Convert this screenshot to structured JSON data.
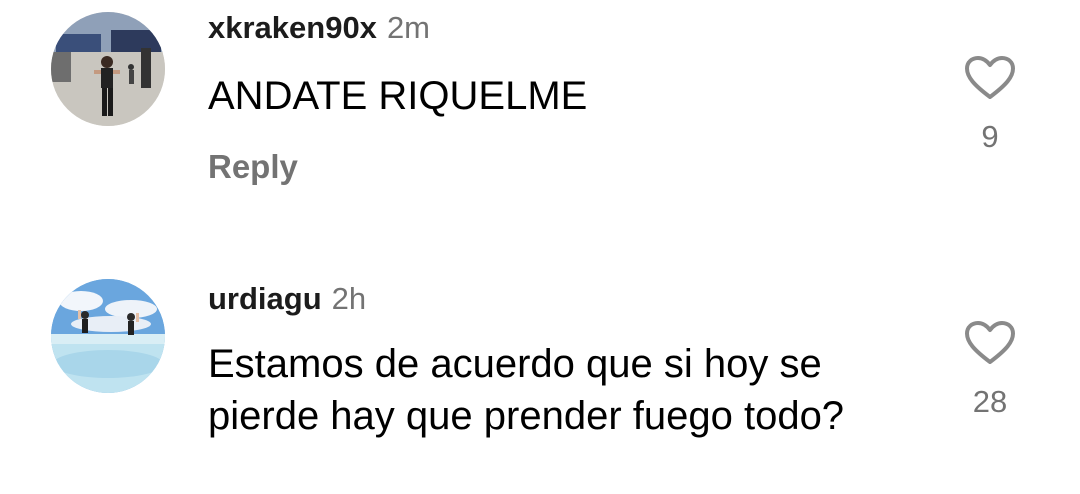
{
  "comments": [
    {
      "username": "xkraken90x",
      "time": "2m",
      "text": "ANDATE RIQUELME",
      "reply_label": "Reply",
      "likes": "9",
      "avatar_icon": "avatar-photo-icon"
    },
    {
      "username": "urdiagu",
      "time": "2h",
      "text": "Estamos de acuerdo que si hoy se pierde hay que prender fuego todo?",
      "likes": "28",
      "avatar_icon": "avatar-photo-icon"
    }
  ],
  "colors": {
    "text_primary": "#000000",
    "text_secondary": "#737373",
    "heart_outline": "#8a8a8a",
    "background": "#ffffff"
  }
}
